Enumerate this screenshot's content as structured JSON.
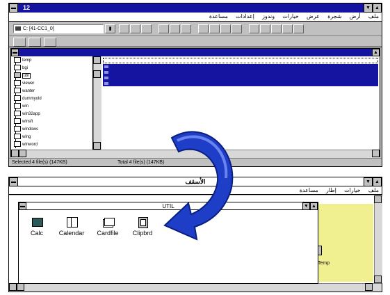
{
  "file_manager": {
    "title": "‏12",
    "menu": [
      "ملف",
      "أرض",
      "شجرة",
      "عرض",
      "خيارات",
      "وندوز",
      "إعدادات",
      "مساعدة"
    ],
    "drive_value": "C: [41-CC1_0]",
    "tree": [
      "temp",
      "bgi",
      "util",
      "viewer",
      "wanter",
      "dummyold",
      "win",
      "win32app",
      "winsft",
      "windows",
      "wing",
      "winword"
    ],
    "status_left": "Selected 4 file(s) (147KB)",
    "status_right": "Total 4 file(s) (147KB)"
  },
  "program_manager": {
    "title": "الأسقف",
    "menu": [
      "ملف",
      "خيارات",
      "إطار",
      "مساعدة"
    ],
    "group_title": "UTIL",
    "icons": [
      {
        "label": "Calc",
        "icon": "calculator-icon"
      },
      {
        "label": "Calendar",
        "icon": "calendar-icon"
      },
      {
        "label": "Cardfile",
        "icon": "cardfile-icon"
      },
      {
        "label": "Clipbrd",
        "icon": "clipboard-icon"
      }
    ],
    "side_label": "Temp"
  },
  "colors": {
    "titlebar": "#1414a0",
    "selection": "#1414a0",
    "arrow": "#1e3ec8",
    "yellow_panel": "#f0f090"
  }
}
